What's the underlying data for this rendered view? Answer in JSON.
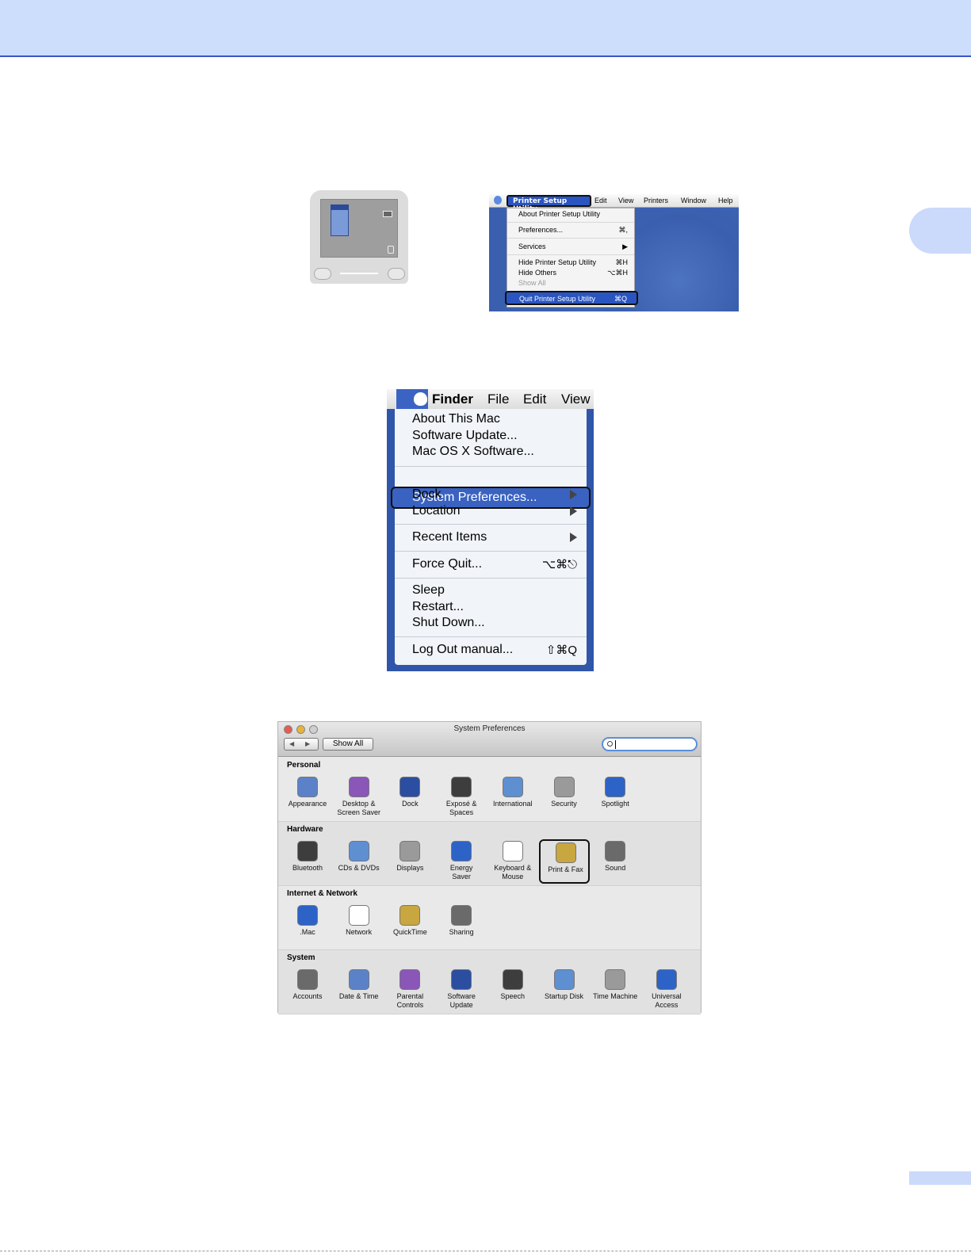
{
  "psu": {
    "menubar": [
      "Edit",
      "View",
      "Printers",
      "Window",
      "Help"
    ],
    "app_menu": "Printer Setup Utility",
    "items": [
      {
        "label": "About Printer Setup Utility",
        "shortcut": ""
      },
      {
        "label": "Preferences...",
        "shortcut": "⌘,"
      },
      {
        "label": "Services",
        "shortcut": ""
      },
      {
        "label": "Hide Printer Setup Utility",
        "shortcut": "⌘H"
      },
      {
        "label": "Hide Others",
        "shortcut": "⌥⌘H"
      },
      {
        "label": "Show All",
        "shortcut": ""
      }
    ],
    "quit": {
      "label": "Quit Printer Setup Utility",
      "shortcut": "⌘Q"
    }
  },
  "finder": {
    "menubar": [
      "Finder",
      "File",
      "Edit",
      "View"
    ],
    "items": {
      "about": "About This Mac",
      "update": "Software Update...",
      "osx": "Mac OS X Software...",
      "sysprefs": "System Preferences...",
      "dock": "Dock",
      "location": "Location",
      "recent": "Recent Items",
      "force_quit": "Force Quit...",
      "force_quit_sc": "⌥⌘⎋",
      "sleep": "Sleep",
      "restart": "Restart...",
      "shutdown": "Shut Down...",
      "logout": "Log Out manual...",
      "logout_sc": "⇧⌘Q"
    }
  },
  "sysprefs": {
    "title": "System Preferences",
    "show_all": "Show All",
    "sections": [
      {
        "name": "Personal",
        "panes": [
          "Appearance",
          "Desktop &\nScreen Saver",
          "Dock",
          "Exposé &\nSpaces",
          "International",
          "Security",
          "Spotlight"
        ]
      },
      {
        "name": "Hardware",
        "panes": [
          "Bluetooth",
          "CDs & DVDs",
          "Displays",
          "Energy\nSaver",
          "Keyboard &\nMouse",
          "Print & Fax",
          "Sound"
        ]
      },
      {
        "name": "Internet & Network",
        "panes": [
          ".Mac",
          "Network",
          "QuickTime",
          "Sharing"
        ]
      },
      {
        "name": "System",
        "panes": [
          "Accounts",
          "Date & Time",
          "Parental\nControls",
          "Software\nUpdate",
          "Speech",
          "Startup Disk",
          "Time Machine",
          "Universal\nAccess"
        ]
      }
    ],
    "highlighted_pane": "Print & Fax"
  },
  "colors": {
    "accent": "#2a55c0",
    "band": "#cdddfc"
  }
}
